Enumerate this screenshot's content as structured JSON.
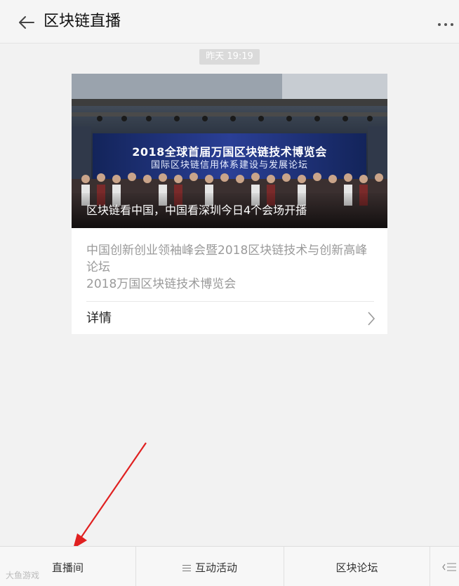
{
  "header": {
    "title": "区块链直播"
  },
  "message": {
    "timestamp": "昨天 19:19",
    "card": {
      "cover_caption": "区块链看中国，中国看深圳今日4个会场开播",
      "banner_line1": "2018全球首届万国区块链技术博览会",
      "banner_line2": "国际区块链信用体系建设与发展论坛",
      "summary_line1": "中国创新创业领袖峰会暨2018区块链技术与创新高峰论坛",
      "summary_line2": "2018万国区块链技术博览会",
      "details_label": "详情"
    }
  },
  "bottom_menu": {
    "items": [
      {
        "label": "直播间",
        "icon": ""
      },
      {
        "label": "互动活动",
        "icon": "menu-lines-icon"
      },
      {
        "label": "区块论坛",
        "icon": ""
      }
    ]
  },
  "watermark": "大鱼游戏",
  "colors": {
    "background": "#f2f2f2",
    "card": "#ffffff",
    "timestamp_bg": "#dadada",
    "annotation_arrow": "#e02020"
  }
}
